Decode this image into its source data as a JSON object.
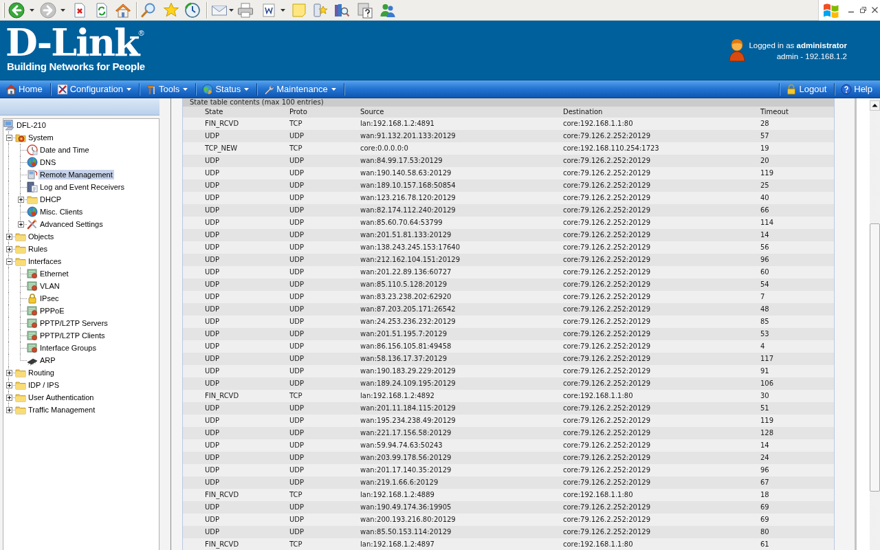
{
  "browser_toolbar": {
    "back": {
      "disabled": false
    },
    "forward": {
      "disabled": true
    }
  },
  "header": {
    "logo": {
      "name": "D-Link",
      "mark": "®",
      "tagline": "Building Networks for People"
    },
    "login": "Logged in as **administrator**",
    "session": "admin - 192.168.1.2"
  },
  "nav": {
    "left": [
      {
        "label": "Home",
        "menu": false
      },
      {
        "label": "Configuration",
        "menu": true
      },
      {
        "label": "Tools",
        "menu": true
      },
      {
        "label": "Status",
        "menu": true
      },
      {
        "label": "Maintenance",
        "menu": true
      }
    ],
    "right": [
      {
        "label": "Logout"
      },
      {
        "label": "Help"
      }
    ]
  },
  "sidebar": {
    "tree": {
      "label": "DFL-210",
      "selected": false,
      "children": [
        {
          "label": "System",
          "selected": false,
          "expanded": true,
          "children": [
            {
              "label": "Date and Time",
              "selected": false
            },
            {
              "label": "DNS",
              "selected": false
            },
            {
              "label": "Remote Management",
              "selected": true
            },
            {
              "label": "Log and Event Receivers",
              "selected": false
            },
            {
              "label": "DHCP",
              "selected": false,
              "expanded": false
            },
            {
              "label": "Misc. Clients",
              "selected": false
            },
            {
              "label": "Advanced Settings",
              "selected": false,
              "expanded": false
            }
          ]
        },
        {
          "label": "Objects",
          "selected": false,
          "expanded": false
        },
        {
          "label": "Rules",
          "selected": false,
          "expanded": false
        },
        {
          "label": "Interfaces",
          "selected": false,
          "expanded": true,
          "children": [
            {
              "label": "Ethernet",
              "selected": false
            },
            {
              "label": "VLAN",
              "selected": false
            },
            {
              "label": "IPsec",
              "selected": false
            },
            {
              "label": "PPPoE",
              "selected": false
            },
            {
              "label": "PPTP/L2TP Servers",
              "selected": false
            },
            {
              "label": "PPTP/L2TP Clients",
              "selected": false
            },
            {
              "label": "Interface Groups",
              "selected": false
            },
            {
              "label": "ARP",
              "selected": false
            }
          ]
        },
        {
          "label": "Routing",
          "selected": false,
          "expanded": false
        },
        {
          "label": "IDP / IPS",
          "selected": false,
          "expanded": false
        },
        {
          "label": "User Authentication",
          "selected": false,
          "expanded": false
        },
        {
          "label": "Traffic Management",
          "selected": false,
          "expanded": false
        }
      ]
    }
  },
  "content": {
    "caption": "State table contents (max 100 entries)",
    "table": {
      "columns": [
        "State",
        "Proto",
        "Source",
        "Destination",
        "Timeout"
      ],
      "rows": [
        [
          "FIN_RCVD",
          "TCP",
          "lan:192.168.1.2:4891",
          "core:192.168.1.1:80",
          "28"
        ],
        [
          "UDP",
          "UDP",
          "wan:91.132.201.133:20129",
          "core:79.126.2.252:20129",
          "57"
        ],
        [
          "TCP_NEW",
          "TCP",
          "core:0.0.0.0:0",
          "core:192.168.110.254:1723",
          "19"
        ],
        [
          "UDP",
          "UDP",
          "wan:84.99.17.53:20129",
          "core:79.126.2.252:20129",
          "20"
        ],
        [
          "UDP",
          "UDP",
          "wan:190.140.58.63:20129",
          "core:79.126.2.252:20129",
          "119"
        ],
        [
          "UDP",
          "UDP",
          "wan:189.10.157.168:50854",
          "core:79.126.2.252:20129",
          "25"
        ],
        [
          "UDP",
          "UDP",
          "wan:123.216.78.120:20129",
          "core:79.126.2.252:20129",
          "40"
        ],
        [
          "UDP",
          "UDP",
          "wan:82.174.112.240:20129",
          "core:79.126.2.252:20129",
          "66"
        ],
        [
          "UDP",
          "UDP",
          "wan:85.60.70.64:53799",
          "core:79.126.2.252:20129",
          "114"
        ],
        [
          "UDP",
          "UDP",
          "wan:201.51.81.133:20129",
          "core:79.126.2.252:20129",
          "14"
        ],
        [
          "UDP",
          "UDP",
          "wan:138.243.245.153:17640",
          "core:79.126.2.252:20129",
          "56"
        ],
        [
          "UDP",
          "UDP",
          "wan:212.162.104.151:20129",
          "core:79.126.2.252:20129",
          "96"
        ],
        [
          "UDP",
          "UDP",
          "wan:201.22.89.136:60727",
          "core:79.126.2.252:20129",
          "60"
        ],
        [
          "UDP",
          "UDP",
          "wan:85.110.5.128:20129",
          "core:79.126.2.252:20129",
          "54"
        ],
        [
          "UDP",
          "UDP",
          "wan:83.23.238.202:62920",
          "core:79.126.2.252:20129",
          "7"
        ],
        [
          "UDP",
          "UDP",
          "wan:87.203.205.171:26542",
          "core:79.126.2.252:20129",
          "48"
        ],
        [
          "UDP",
          "UDP",
          "wan:24.253.236.232:20129",
          "core:79.126.2.252:20129",
          "85"
        ],
        [
          "UDP",
          "UDP",
          "wan:201.51.195.7:20129",
          "core:79.126.2.252:20129",
          "53"
        ],
        [
          "UDP",
          "UDP",
          "wan:86.156.105.81:49458",
          "core:79.126.2.252:20129",
          "4"
        ],
        [
          "UDP",
          "UDP",
          "wan:58.136.17.37:20129",
          "core:79.126.2.252:20129",
          "117"
        ],
        [
          "UDP",
          "UDP",
          "wan:190.183.29.229:20129",
          "core:79.126.2.252:20129",
          "91"
        ],
        [
          "UDP",
          "UDP",
          "wan:189.24.109.195:20129",
          "core:79.126.2.252:20129",
          "106"
        ],
        [
          "FIN_RCVD",
          "TCP",
          "lan:192.168.1.2:4892",
          "core:192.168.1.1:80",
          "30"
        ],
        [
          "UDP",
          "UDP",
          "wan:201.11.184.115:20129",
          "core:79.126.2.252:20129",
          "51"
        ],
        [
          "UDP",
          "UDP",
          "wan:195.234.238.49:20129",
          "core:79.126.2.252:20129",
          "119"
        ],
        [
          "UDP",
          "UDP",
          "wan:221.17.156.58:20129",
          "core:79.126.2.252:20129",
          "128"
        ],
        [
          "UDP",
          "UDP",
          "wan:59.94.74.63:50243",
          "core:79.126.2.252:20129",
          "14"
        ],
        [
          "UDP",
          "UDP",
          "wan:203.99.178.56:20129",
          "core:79.126.2.252:20129",
          "24"
        ],
        [
          "UDP",
          "UDP",
          "wan:201.17.140.35:20129",
          "core:79.126.2.252:20129",
          "96"
        ],
        [
          "UDP",
          "UDP",
          "wan:219.1.66.6:20129",
          "core:79.126.2.252:20129",
          "67"
        ],
        [
          "FIN_RCVD",
          "TCP",
          "lan:192.168.1.2:4889",
          "core:192.168.1.1:80",
          "18"
        ],
        [
          "UDP",
          "UDP",
          "wan:190.49.174.36:19905",
          "core:79.126.2.252:20129",
          "69"
        ],
        [
          "UDP",
          "UDP",
          "wan:200.193.216.80:20129",
          "core:79.126.2.252:20129",
          "69"
        ],
        [
          "UDP",
          "UDP",
          "wan:85.50.153.114:20129",
          "core:79.126.2.252:20129",
          "80"
        ],
        [
          "FIN_RCVD",
          "TCP",
          "lan:192.168.1.2:4897",
          "core:192.168.1.1:80",
          "61"
        ]
      ]
    }
  }
}
